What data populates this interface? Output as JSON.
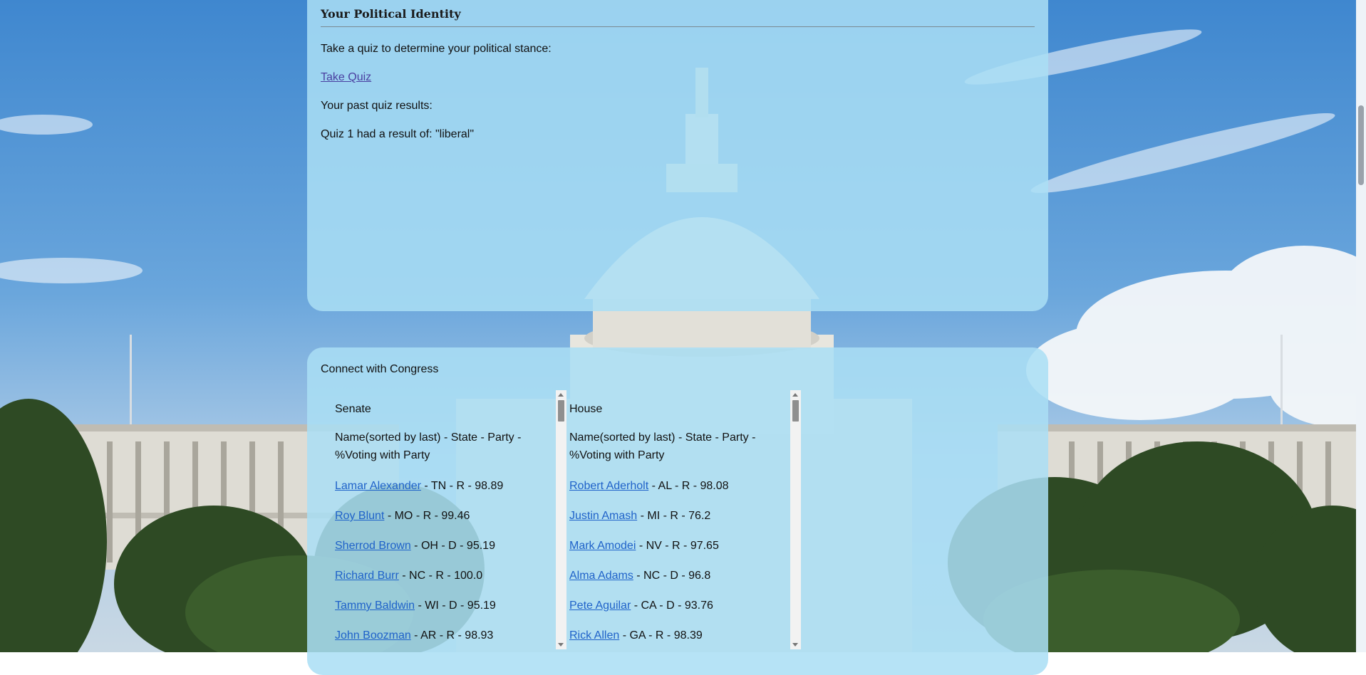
{
  "identity": {
    "title": "Your Political Identity",
    "quiz_prompt": "Take a quiz to determine your political stance:",
    "quiz_link": "Take Quiz",
    "past_results_label": "Your past quiz results:",
    "result_prefix": "Quiz 1 had a result of: ",
    "result_value": "\"liberal\""
  },
  "congress": {
    "title": "Connect with Congress",
    "senate": {
      "heading": "Senate",
      "columns": "Name(sorted by last) - State - Party - %Voting with Party",
      "members": [
        {
          "name": "Lamar Alexander",
          "details": " - TN - R - 98.89"
        },
        {
          "name": "Roy Blunt",
          "details": " - MO - R - 99.46"
        },
        {
          "name": "Sherrod Brown",
          "details": " - OH - D - 95.19"
        },
        {
          "name": "Richard Burr",
          "details": " - NC - R - 100.0"
        },
        {
          "name": "Tammy Baldwin",
          "details": " - WI - D - 95.19"
        },
        {
          "name": "John Boozman",
          "details": " - AR - R - 98.93"
        }
      ]
    },
    "house": {
      "heading": "House",
      "columns": "Name(sorted by last) - State - Party - %Voting with Party",
      "members": [
        {
          "name": "Robert Aderholt",
          "details": " - AL - R - 98.08"
        },
        {
          "name": "Justin Amash",
          "details": " - MI - R - 76.2"
        },
        {
          "name": "Mark Amodei",
          "details": " - NV - R - 97.65"
        },
        {
          "name": "Alma Adams",
          "details": " - NC - D - 96.8"
        },
        {
          "name": "Pete Aguilar",
          "details": " - CA - D - 93.76"
        },
        {
          "name": "Rick Allen",
          "details": " - GA - R - 98.39"
        }
      ]
    }
  },
  "colors": {
    "panel": "#aadef5",
    "link": "#1f62c9",
    "visited_link": "#4a3fa0"
  }
}
